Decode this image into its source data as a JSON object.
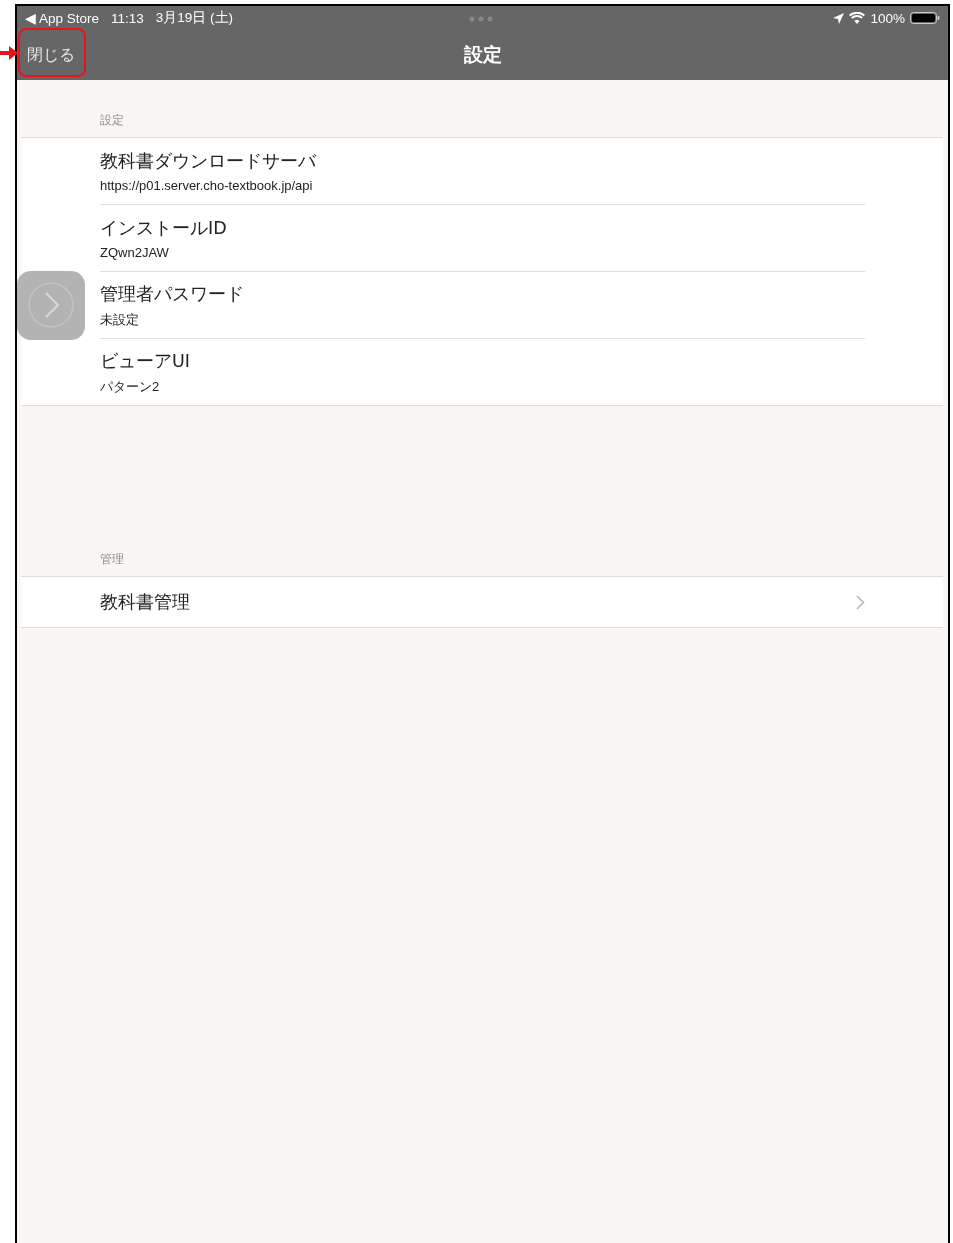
{
  "status_bar": {
    "back_app": "◀ App Store",
    "time": "11:13",
    "date": "3月19日 (土)",
    "battery": "100%"
  },
  "nav_bar": {
    "close_button": {
      "label": "閉じる",
      "highlighted": true
    },
    "title": "設定"
  },
  "sections": [
    {
      "header": "設定",
      "rows": [
        {
          "kind": "detail",
          "title": "教科書ダウンロードサーバ",
          "subtitle": "https://p01.server.cho-textbook.jp/api"
        },
        {
          "kind": "detail",
          "title": "インストールID",
          "subtitle": "ZQwn2JAW"
        },
        {
          "kind": "detail",
          "title": "管理者パスワード",
          "subtitle": "未設定"
        },
        {
          "kind": "detail",
          "title": "ビューアUI",
          "subtitle": "パターン2"
        }
      ]
    },
    {
      "header": "管理",
      "rows": [
        {
          "kind": "disclosure",
          "title": "教科書管理"
        }
      ]
    }
  ]
}
